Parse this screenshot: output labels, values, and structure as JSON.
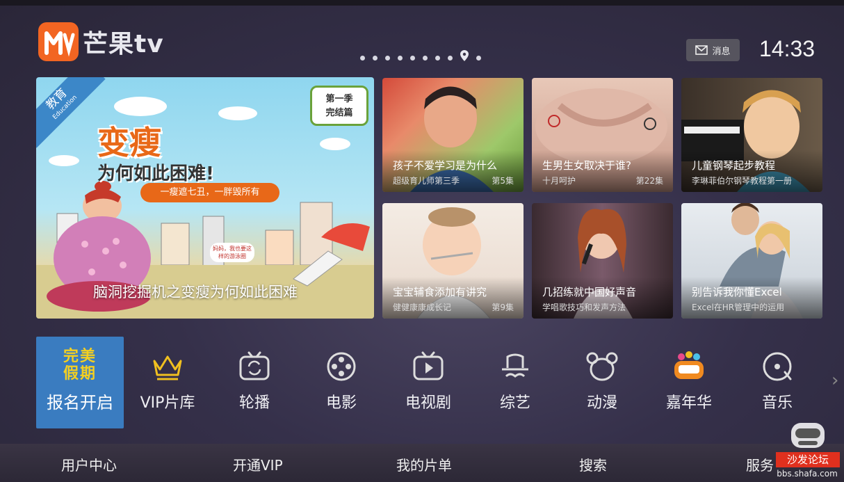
{
  "header": {
    "app_name": "芒果tv",
    "message_label": "消息",
    "time": "14:33",
    "page_count": 10,
    "active_page": 9
  },
  "hero": {
    "category_cn": "教育",
    "category_en": "Education",
    "season_line1": "第一季",
    "season_line2": "完结篇",
    "poster_headline_1": "变瘦",
    "poster_headline_2": "为何如此困难!",
    "poster_slogan": "一瘦遮七丑，一胖毁所有",
    "poster_bubble": "妈妈，我也要这样的游泳圈",
    "title": "脑洞挖掘机之变瘦为何如此困难"
  },
  "tiles": [
    {
      "title": "孩子不爱学习是为什么",
      "subtitle": "超级育儿师第三季",
      "episode": "第5集"
    },
    {
      "title": "生男生女取决于谁?",
      "subtitle": "十月呵护",
      "episode": "第22集"
    },
    {
      "title": "儿童钢琴起步教程",
      "subtitle": "李琳菲伯尔钢琴教程第一册",
      "episode": ""
    },
    {
      "title": "宝宝辅食添加有讲究",
      "subtitle": "健健康康成长记",
      "episode": "第9集"
    },
    {
      "title": "几招练就中国好声音",
      "subtitle": "学唱歌技巧和发声方法",
      "episode": ""
    },
    {
      "title": "别告诉我你懂Excel",
      "subtitle": "Excel在HR管理中的运用",
      "episode": ""
    }
  ],
  "nav": {
    "featured_promo_1": "完美",
    "featured_promo_2": "假期",
    "featured_label": "报名开启",
    "items": [
      {
        "label": "VIP片库",
        "icon": "crown-icon"
      },
      {
        "label": "轮播",
        "icon": "carousel-tv-icon"
      },
      {
        "label": "电影",
        "icon": "film-reel-icon"
      },
      {
        "label": "电视剧",
        "icon": "tv-play-icon"
      },
      {
        "label": "综艺",
        "icon": "hat-mustache-icon"
      },
      {
        "label": "动漫",
        "icon": "bear-icon"
      },
      {
        "label": "嘉年华",
        "icon": "carnival-badge-icon"
      },
      {
        "label": "音乐",
        "icon": "music-disc-icon"
      }
    ]
  },
  "bottom_bar": {
    "user_center": "用户中心",
    "open_vip": "开通VIP",
    "my_list": "我的片单",
    "search": "搜索",
    "service": "服务"
  },
  "watermark": {
    "name": "沙发论坛",
    "url": "bbs.shafa.com"
  },
  "colors": {
    "brand": "#f26522",
    "featured_bg": "#3a7cc0",
    "watermark_red": "#e0301e"
  }
}
